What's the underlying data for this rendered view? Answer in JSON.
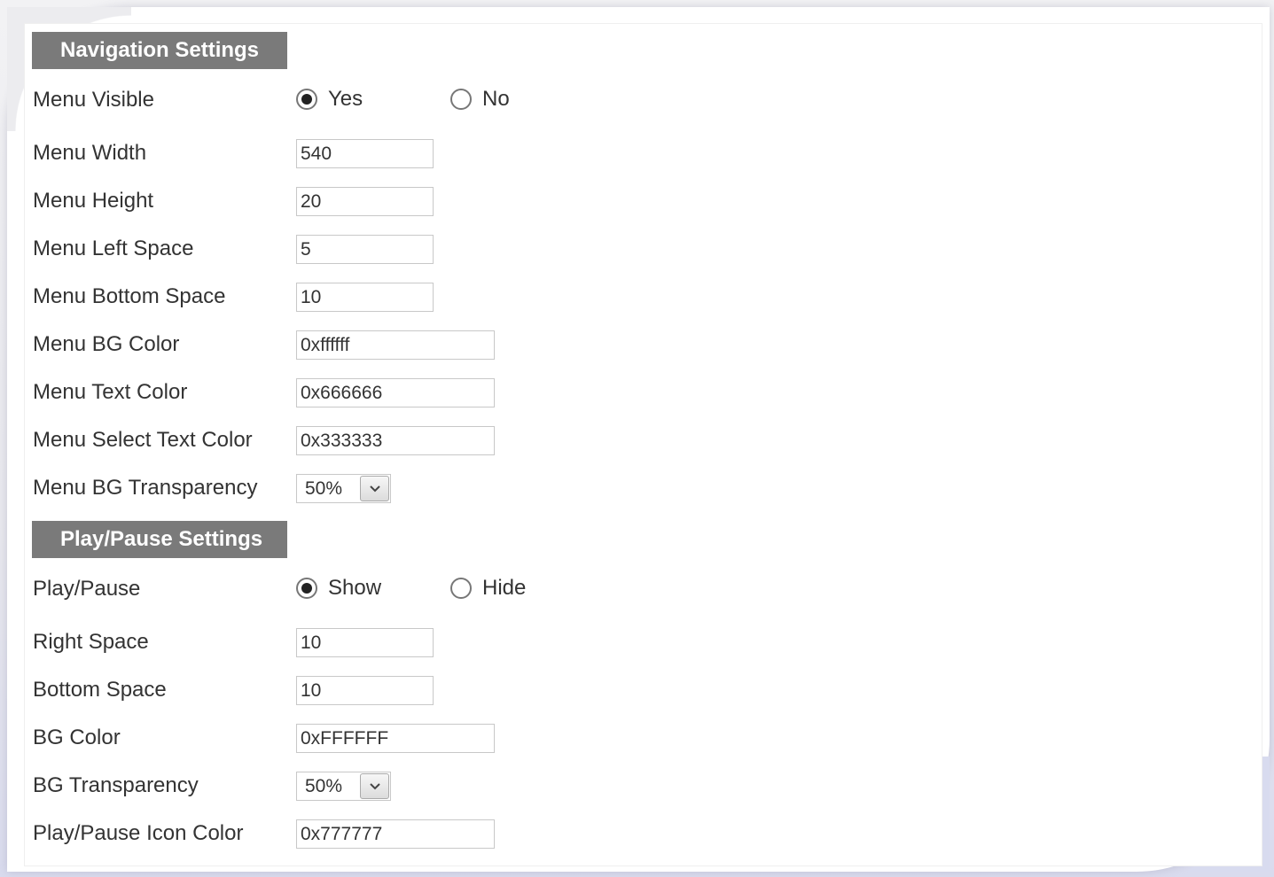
{
  "navigation": {
    "header": "Navigation Settings",
    "menu_visible": {
      "label": "Menu Visible",
      "options": [
        "Yes",
        "No"
      ],
      "selected": "Yes"
    },
    "menu_width": {
      "label": "Menu Width",
      "value": "540"
    },
    "menu_height": {
      "label": "Menu Height",
      "value": "20"
    },
    "menu_left_space": {
      "label": "Menu Left Space",
      "value": "5"
    },
    "menu_bottom_space": {
      "label": "Menu Bottom Space",
      "value": "10"
    },
    "menu_bg_color": {
      "label": "Menu BG Color",
      "value": "0xffffff"
    },
    "menu_text_color": {
      "label": "Menu Text Color",
      "value": "0x666666"
    },
    "menu_select_text_color": {
      "label": "Menu Select Text Color",
      "value": "0x333333"
    },
    "menu_bg_transparency": {
      "label": "Menu BG Transparency",
      "value": "50%"
    }
  },
  "play_pause": {
    "header": "Play/Pause Settings",
    "play_pause": {
      "label": "Play/Pause",
      "options": [
        "Show",
        "Hide"
      ],
      "selected": "Show"
    },
    "right_space": {
      "label": "Right Space",
      "value": "10"
    },
    "bottom_space": {
      "label": "Bottom Space",
      "value": "10"
    },
    "bg_color": {
      "label": "BG Color",
      "value": "0xFFFFFF"
    },
    "bg_transparency": {
      "label": "BG Transparency",
      "value": "50%"
    },
    "icon_color": {
      "label": "Play/Pause Icon Color",
      "value": "0x777777"
    }
  },
  "icons": {
    "dropdown": "chevron-down-icon",
    "radio": "radio-button-icon"
  },
  "colors": {
    "section_header_bg": "#7a7a7a",
    "section_header_text": "#ffffff",
    "label_text": "#333333",
    "field_border": "#c8c8c8"
  }
}
